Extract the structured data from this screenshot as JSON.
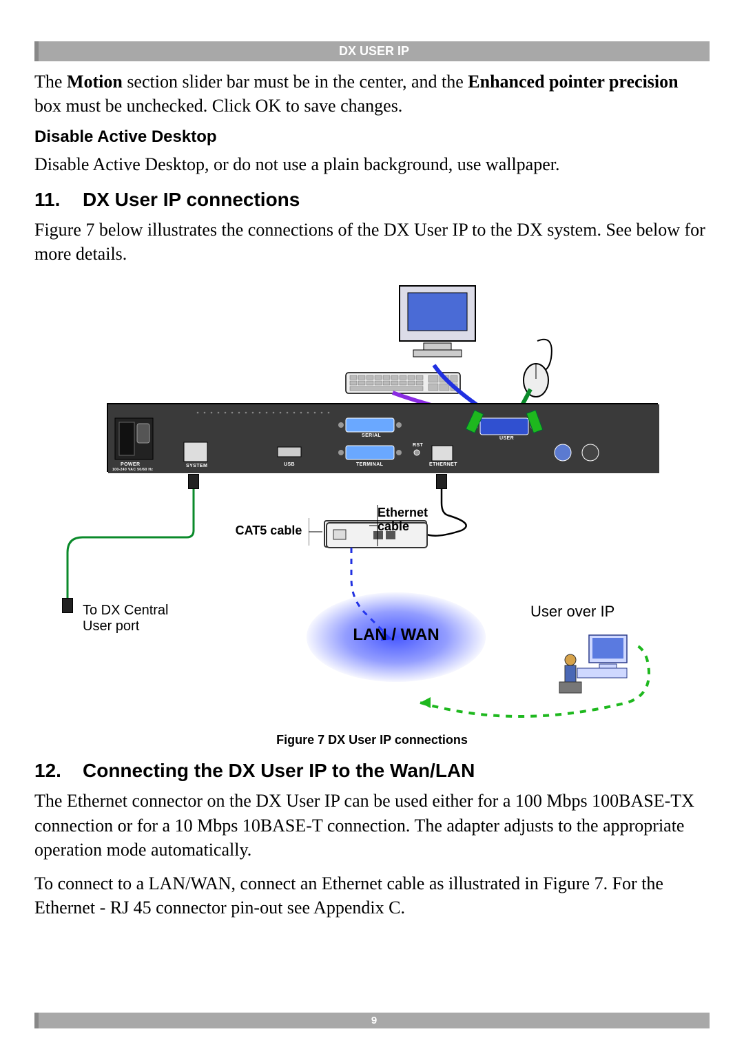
{
  "header": {
    "title": "DX USER IP"
  },
  "intro": {
    "prefix": "The ",
    "bold1": "Motion",
    "mid1": " section slider bar must be in the center, and the ",
    "bold2": "Enhanced pointer precision",
    "suffix": " box must be unchecked. Click OK to save changes."
  },
  "disable_heading": "Disable Active Desktop",
  "disable_text": "Disable Active Desktop, or do not use a plain background, use wallpaper.",
  "section11": {
    "num": "11.",
    "title": "DX User IP connections",
    "text": "Figure 7 below illustrates the connections of the DX User IP to the DX system. See below for more details."
  },
  "diagram": {
    "labels": {
      "power": "POWER",
      "power_sub": "100-240 VAC 50/60 Hz",
      "system": "SYSTEM",
      "serial": "SERIAL",
      "terminal": "TERMINAL",
      "usb": "USB",
      "rst": "RST",
      "ethernet_port": "ETHERNET",
      "user": "USER"
    },
    "cat5": "CAT5 cable",
    "ethernet": "Ethernet cable",
    "to_dx_line1": "To DX Central",
    "to_dx_line2": "User port",
    "user_over_ip": "User over IP",
    "lan_wan": "LAN / WAN"
  },
  "figure_caption": "Figure 7 DX User IP connections",
  "section12": {
    "num": "12.",
    "title": "Connecting the DX User IP to the Wan/LAN",
    "p1": "The Ethernet connector on the DX User IP can be used either for a 100 Mbps 100BASE-TX connection or for a 10 Mbps 10BASE-T connection. The adapter adjusts to the appropriate operation mode automatically.",
    "p2": "To connect to a LAN/WAN, connect an Ethernet cable as illustrated in Figure 7. For the Ethernet - RJ 45 connector pin-out see Appendix C."
  },
  "footer": {
    "page": "9"
  }
}
